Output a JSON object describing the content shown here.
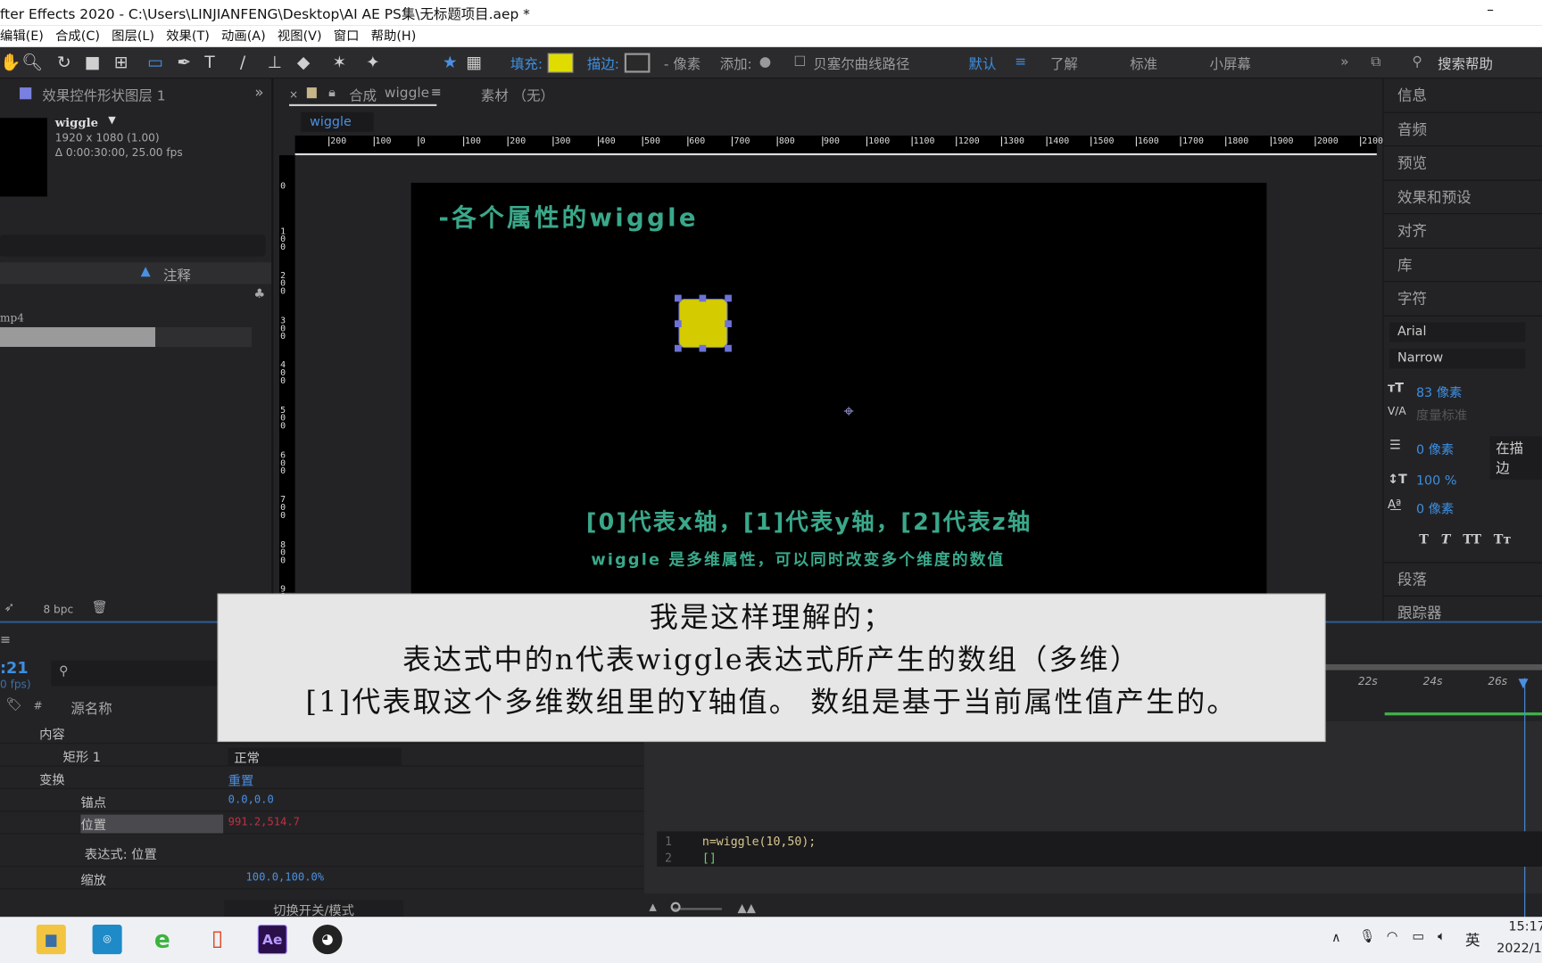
{
  "window": {
    "title": "fter Effects 2020 - C:\\Users\\LINJIANFENG\\Desktop\\AI AE PS集\\无标题项目.aep *",
    "minimize": "–"
  },
  "menu": [
    "编辑(E)",
    "合成(C)",
    "图层(L)",
    "效果(T)",
    "动画(A)",
    "视图(V)",
    "窗口",
    "帮助(H)"
  ],
  "toolbar": {
    "fill_label": "填充:",
    "fill_color": "#e0dc00",
    "stroke_label": "描边:",
    "stroke_px": "- 像素",
    "add_label": "添加:",
    "bezier_label": "贝塞尔曲线路径",
    "workspaces": [
      "默认",
      "了解",
      "标准",
      "小屏幕"
    ],
    "search_placeholder": "搜索帮助"
  },
  "effects_panel": {
    "title": "效果控件形状图层 1",
    "comp_name": "wiggle",
    "comp_size": "1920 x 1080 (1.00)",
    "comp_duration": "Δ 0:00:30:00, 25.00 fps",
    "notes_label": "注释",
    "file_suffix": "mp4",
    "bpc": "8 bpc"
  },
  "comp_panel": {
    "tab_label": "合成",
    "tab_name": "wiggle",
    "footage_tab": "素材 （无）",
    "breadcrumb": "wiggle",
    "ruler_h": [
      "200",
      "100",
      "0",
      "100",
      "200",
      "300",
      "400",
      "500",
      "600",
      "700",
      "800",
      "900",
      "1000",
      "1100",
      "1200",
      "1300",
      "1400",
      "1500",
      "1600",
      "1700",
      "1800",
      "1900",
      "2000",
      "2100"
    ],
    "ruler_v": [
      "0",
      "100",
      "200",
      "300",
      "400",
      "500",
      "600",
      "700",
      "800",
      "900"
    ],
    "title_text": "-各个属性的wiggle",
    "line1": "[0]代表x轴，[1]代表y轴，[2]代表z轴",
    "line2": "wiggle 是多维属性，可以同时改变多个维度的数值",
    "shape_color": "#d4cc00"
  },
  "overlay": {
    "line1": "我是这样理解的；",
    "line2": "表达式中的n代表wiggle表达式所产生的数组（多维）",
    "line3": "[1]代表取这个多维数组里的Y轴值。 数组是基于当前属性值产生的。"
  },
  "right_panel": {
    "items": [
      "信息",
      "音频",
      "预览",
      "效果和预设",
      "对齐",
      "库",
      "字符"
    ],
    "font": "Arial",
    "style": "Narrow",
    "size": "83 像素",
    "kerning": "度量标准",
    "stroke_width": "0 像素",
    "stroke_mode": "在描边",
    "vscale": "100 %",
    "baseline": "0 像素",
    "more_items": [
      "段落",
      "跟踪器"
    ]
  },
  "timeline": {
    "timecode": ":21",
    "fps": "0 fps)",
    "col_name": "源名称",
    "rows": [
      {
        "name": "内容"
      },
      {
        "name": "矩形 1",
        "value": "正常"
      },
      {
        "name": "变换",
        "value": "重置"
      },
      {
        "name": "锚点",
        "value": "0.0,0.0"
      },
      {
        "name": "位置",
        "value": "991.2,514.7"
      },
      {
        "name": "表达式: 位置"
      },
      {
        "name": "缩放",
        "value": "100.0,100.0%"
      }
    ],
    "toggle_label": "切换开关/模式",
    "time_ticks": [
      "22s",
      "24s",
      "26s"
    ],
    "code": [
      {
        "num": "1",
        "text": "n=wiggle(10,50);"
      },
      {
        "num": "2",
        "text": "[]"
      }
    ]
  },
  "taskbar": {
    "time": "15:17",
    "date": "2022/1",
    "ime": "英"
  }
}
